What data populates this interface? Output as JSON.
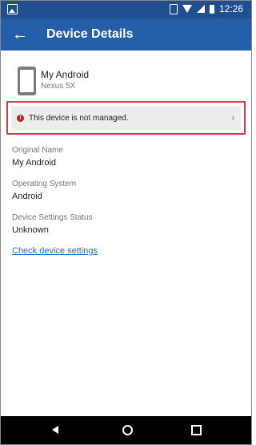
{
  "status": {
    "time": "12:26"
  },
  "toolbar": {
    "title": "Device Details",
    "back_icon": "arrow-left"
  },
  "device": {
    "name": "My Android",
    "model": "Nexus 5X"
  },
  "warning": {
    "message": "This device is not managed.",
    "color": "#b3261e"
  },
  "fields": [
    {
      "label": "Original Name",
      "value": "My Android"
    },
    {
      "label": "Operating System",
      "value": "Android"
    },
    {
      "label": "Device Settings Status",
      "value": "Unknown"
    }
  ],
  "link": {
    "label": "Check device settings"
  }
}
